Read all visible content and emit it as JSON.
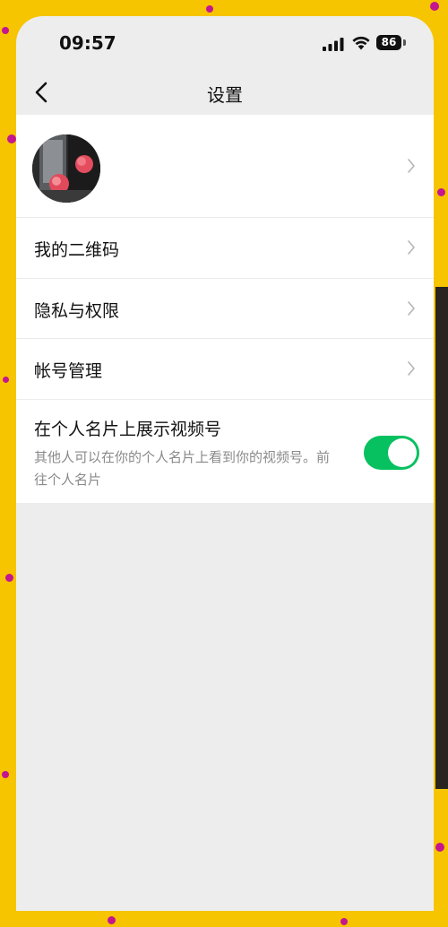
{
  "status_bar": {
    "time": "09:57",
    "battery": "86",
    "signal_icon": "cellular-signal-icon",
    "wifi_icon": "wifi-icon"
  },
  "nav": {
    "back_icon": "chevron-left-icon",
    "title": "设置"
  },
  "settings": {
    "profile": {
      "avatar": "profile-avatar",
      "chevron_icon": "chevron-right-icon"
    },
    "items": [
      {
        "label": "我的二维码"
      },
      {
        "label": "隐私与权限"
      },
      {
        "label": "帐号管理"
      }
    ],
    "channel_card": {
      "label": "在个人名片上展示视频号",
      "description": "其他人可以在你的个人名片上看到你的视频号。前往个人名片",
      "toggle_state": "on"
    }
  },
  "colors": {
    "accent": "#07c160",
    "background": "#ededed",
    "frame": "#f7c400"
  }
}
